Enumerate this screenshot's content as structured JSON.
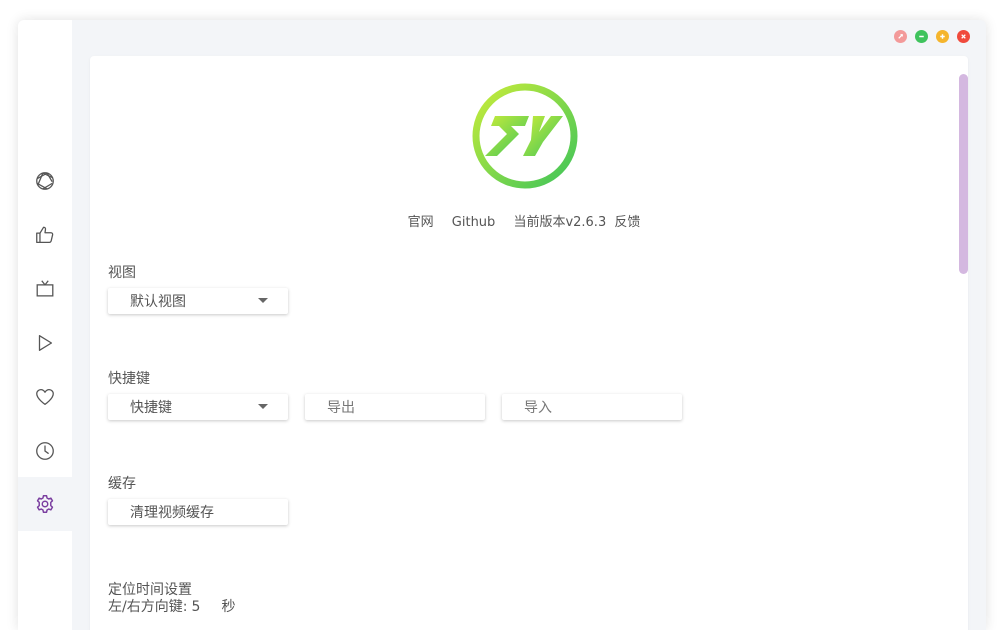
{
  "window": {
    "controls": [
      {
        "name": "fullscreen",
        "color": "#f39a9a"
      },
      {
        "name": "minimize",
        "color": "#3fc35d"
      },
      {
        "name": "maximize",
        "color": "#f5b52d"
      },
      {
        "name": "close",
        "color": "#f04a3c"
      }
    ]
  },
  "sidebar": {
    "items": [
      {
        "icon": "aperture-icon"
      },
      {
        "icon": "thumbs-up-icon"
      },
      {
        "icon": "tv-icon"
      },
      {
        "icon": "play-icon"
      },
      {
        "icon": "heart-icon"
      },
      {
        "icon": "clock-icon"
      },
      {
        "icon": "gear-icon",
        "active": true
      }
    ],
    "accent_color": "#7b3fa0"
  },
  "about": {
    "logo_text": "ZY",
    "links": {
      "website": "官网",
      "github": "Github",
      "version": "当前版本v2.6.3",
      "feedback": "反馈"
    }
  },
  "settings": {
    "view": {
      "label": "视图",
      "selected": "默认视图"
    },
    "shortcuts": {
      "label": "快捷键",
      "selected": "快捷键",
      "export_label": "导出",
      "import_label": "导入"
    },
    "cache": {
      "label": "缓存",
      "clear_button": "清理视频缓存"
    },
    "seek": {
      "label": "定位时间设置",
      "arrow_label": "左/右方向键:",
      "value": "5",
      "unit": "秒"
    }
  }
}
